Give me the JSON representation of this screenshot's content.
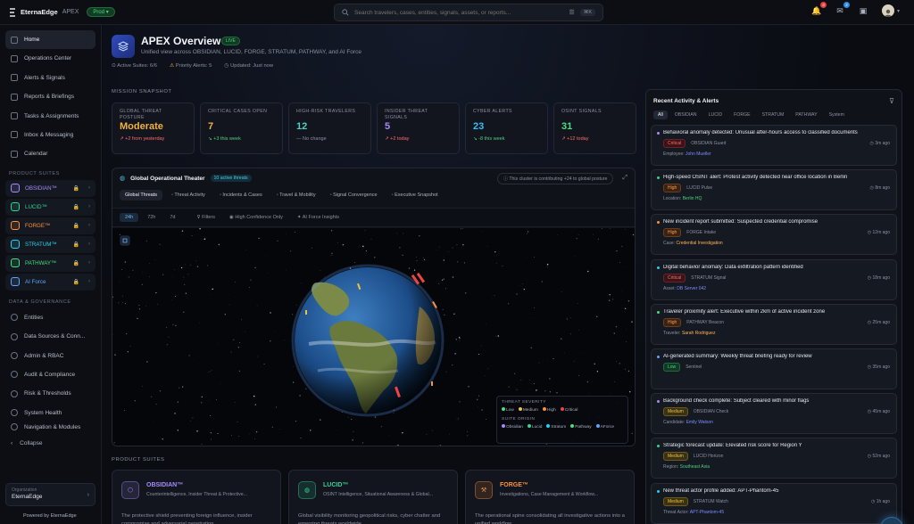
{
  "app": {
    "brand": "EternaEdge",
    "product": "APEX",
    "env": "Prod"
  },
  "search": {
    "placeholder": "Search travelers, cases, entities, signals, assets, or reports...",
    "shortcut": "⌘K"
  },
  "top_badges": {
    "notifications": "3",
    "inbox": "2"
  },
  "sidebar": {
    "nav": [
      {
        "label": "Home",
        "active": true
      },
      {
        "label": "Operations Center"
      },
      {
        "label": "Alerts & Signals"
      },
      {
        "label": "Reports & Briefings"
      },
      {
        "label": "Tasks & Assignments"
      },
      {
        "label": "Inbox & Messaging"
      },
      {
        "label": "Calendar"
      }
    ],
    "suites_title": "PRODUCT SUITES",
    "suites": [
      {
        "label": "OBSIDIAN™",
        "color": "#a78bfa"
      },
      {
        "label": "LUCID™",
        "color": "#34d399"
      },
      {
        "label": "FORGE™",
        "color": "#fb923c"
      },
      {
        "label": "STRATUM™",
        "color": "#22d3ee"
      },
      {
        "label": "PATHWAY™",
        "color": "#4ade80"
      },
      {
        "label": "AI Force",
        "color": "#60a5fa"
      }
    ],
    "gov_title": "DATA & GOVERNANCE",
    "gov": [
      {
        "label": "Entities"
      },
      {
        "label": "Data Sources & Conn..."
      },
      {
        "label": "Admin & RBAC"
      },
      {
        "label": "Audit & Compliance"
      },
      {
        "label": "Risk & Thresholds"
      },
      {
        "label": "System Health"
      },
      {
        "label": "Navigation & Modules"
      }
    ],
    "collapse": "Collapse",
    "org_label": "Organization",
    "org_value": "EternaEdge",
    "powered": "Powered by EternaEdge"
  },
  "header": {
    "title": "APEX Overview",
    "live": "LIVE",
    "subtitle": "Unified view across OBSIDIAN, LUCID, FORGE, STRATUM, PATHWAY, and AI Force",
    "active_suites": "Active Suites: 6/6",
    "priority_alerts": "Priority Alerts: 5",
    "updated": "Updated: Just now"
  },
  "snapshot": {
    "title": "MISSION SNAPSHOT",
    "kpis": [
      {
        "label": "GLOBAL THREAT POSTURE",
        "value": "Moderate",
        "delta": "↗ +2 from yesterday",
        "color": "#f0b23e",
        "dcolor": "#ff6b6b"
      },
      {
        "label": "CRITICAL CASES OPEN",
        "value": "7",
        "delta": "↘ +3 this week",
        "color": "#f0b23e",
        "dcolor": "#4fd17e"
      },
      {
        "label": "HIGH-RISK TRAVELERS",
        "value": "12",
        "delta": "— No change",
        "color": "#4fd1c5",
        "dcolor": "#8a91a0"
      },
      {
        "label": "INSIDER THREAT SIGNALS",
        "value": "5",
        "delta": "↗ +2 today",
        "color": "#a78bfa",
        "dcolor": "#ff6b6b"
      },
      {
        "label": "CYBER ALERTS",
        "value": "23",
        "delta": "↘ -8 this week",
        "color": "#38bdf8",
        "dcolor": "#4fd17e"
      },
      {
        "label": "OSINT SIGNALS",
        "value": "31",
        "delta": "↗ +12 today",
        "color": "#4ade80",
        "dcolor": "#ff6b6b"
      }
    ]
  },
  "theater": {
    "title": "Global Operational Theater",
    "badge": "10 active threats",
    "note": "This cluster is contributing +24 to global posture",
    "tabs": [
      "Global Threats",
      "Threat Activity",
      "Incidents & Cases",
      "Travel & Mobility",
      "Signal Convergence",
      "Executive Snapshot"
    ],
    "filters": [
      "24h",
      "72h",
      "7d",
      "Filters",
      "High Confidence Only",
      "AI Force Insights"
    ],
    "legend": {
      "sev_title": "THREAT SEVERITY",
      "sev": [
        {
          "label": "Low",
          "color": "#4ade80"
        },
        {
          "label": "Medium",
          "color": "#f0c23e"
        },
        {
          "label": "High",
          "color": "#fb923c"
        },
        {
          "label": "Critical",
          "color": "#ef4444"
        }
      ],
      "suite_title": "SUITE ORIGIN",
      "suites": [
        {
          "label": "Obsidian",
          "color": "#a78bfa"
        },
        {
          "label": "Lucid",
          "color": "#34d399"
        },
        {
          "label": "Stratum",
          "color": "#22d3ee"
        },
        {
          "label": "Pathway",
          "color": "#4ade80"
        },
        {
          "label": "AForce",
          "color": "#60a5fa"
        }
      ]
    }
  },
  "product_suites": {
    "title": "PRODUCT SUITES",
    "cards": [
      {
        "name": "OBSIDIAN™",
        "desc": "Counterintelligence, Insider Threat & Protective...",
        "text": "The protective shield preventing foreign influence, insider compromise and adversarial penetration.",
        "color": "#a78bfa"
      },
      {
        "name": "LUCID™",
        "desc": "OSINT Intelligence, Situational Awareness & Global...",
        "text": "Global visibility monitoring geopolitical risks, cyber chatter and emerging threats worldwide.",
        "color": "#34d399"
      },
      {
        "name": "FORGE™",
        "desc": "Investigations, Case Management & Workflow...",
        "text": "The operational spine consolidating all investigative actions into a unified workflow.",
        "color": "#fb923c"
      }
    ]
  },
  "activity": {
    "title": "Recent Activity & Alerts",
    "tabs": [
      "All",
      "OBSIDIAN",
      "LUCID",
      "FORGE",
      "STRATUM",
      "PATHWAY",
      "System"
    ],
    "items": [
      {
        "title": "Behavioral anomaly detected: Unusual after-hours access to classified documents",
        "sev": "Critical",
        "sevc": "critical",
        "src": "OBSIDIAN Guard",
        "time": "3m ago",
        "mk": "Employee:",
        "mv": "John Mueller",
        "mc": "",
        "bc": "#a78bfa"
      },
      {
        "title": "High-speed OSINT alert: Protest activity detected near office location in Berlin",
        "sev": "High",
        "sevc": "high",
        "src": "LUCID Pulse",
        "time": "8m ago",
        "mk": "Location:",
        "mv": "Berlin HQ",
        "mc": "loc",
        "bc": "#34d399"
      },
      {
        "title": "New incident report submitted: Suspected credential compromise",
        "sev": "High",
        "sevc": "high",
        "src": "FORGE Intake",
        "time": "12m ago",
        "mk": "Case:",
        "mv": "Credential Investigation",
        "mc": "ent",
        "bc": "#fb923c"
      },
      {
        "title": "Digital behavior anomaly: Data exfiltration pattern identified",
        "sev": "Critical",
        "sevc": "critical",
        "src": "STRATUM Signal",
        "time": "18m ago",
        "mk": "Asset:",
        "mv": "DB Server 042",
        "mc": "",
        "bc": "#22d3ee"
      },
      {
        "title": "Traveler proximity alert: Executive within 2km of active incident zone",
        "sev": "High",
        "sevc": "high",
        "src": "PATHWAY Beacon",
        "time": "25m ago",
        "mk": "Traveler:",
        "mv": "Sarah Rodriguez",
        "mc": "trav",
        "bc": "#4ade80"
      },
      {
        "title": "AI-generated summary: Weekly threat briefing ready for review",
        "sev": "Low",
        "sevc": "low",
        "src": "Sentinel",
        "time": "35m ago",
        "mk": "",
        "mv": "",
        "mc": "",
        "bc": "#60a5fa"
      },
      {
        "title": "Background check complete: Subject cleared with minor flags",
        "sev": "Medium",
        "sevc": "medium",
        "src": "OBSIDIAN Check",
        "time": "45m ago",
        "mk": "Candidate:",
        "mv": "Emily Watson",
        "mc": "",
        "bc": "#a78bfa"
      },
      {
        "title": "Strategic forecast update: Elevated risk score for Region Y",
        "sev": "Medium",
        "sevc": "medium",
        "src": "LUCID Horizon",
        "time": "52m ago",
        "mk": "Region:",
        "mv": "Southeast Asia",
        "mc": "loc",
        "bc": "#34d399"
      },
      {
        "title": "New threat actor profile added: APT-Phantom-45",
        "sev": "Medium",
        "sevc": "medium",
        "src": "STRATUM Watch",
        "time": "1h ago",
        "mk": "Threat Actor:",
        "mv": "APT-Phantom-45",
        "mc": "",
        "bc": "#22d3ee"
      }
    ]
  }
}
